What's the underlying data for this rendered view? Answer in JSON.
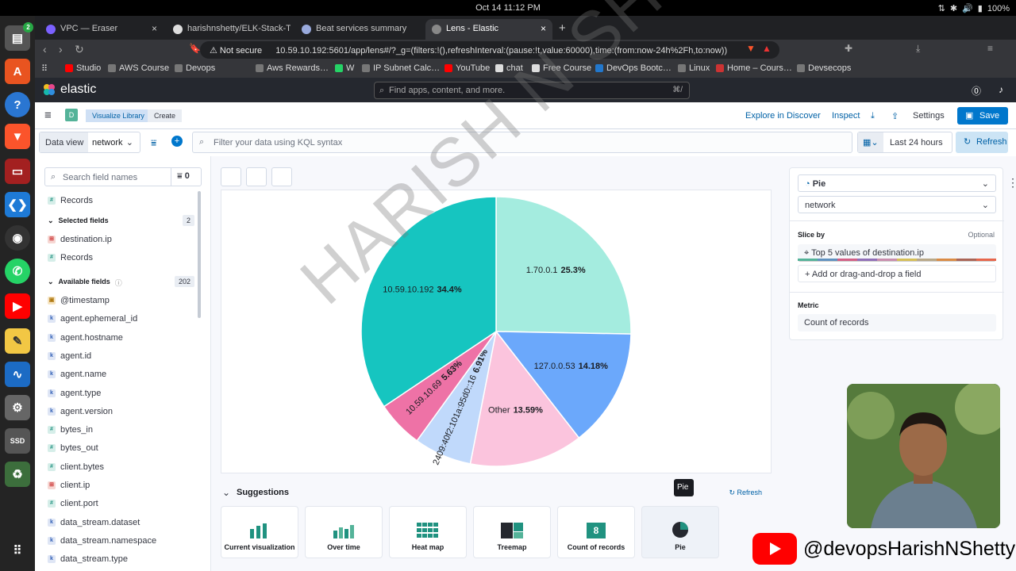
{
  "os": {
    "clock": "Oct 14  11:12 PM",
    "battery": "100%",
    "dock_badge": "2"
  },
  "browser": {
    "tabs": [
      {
        "label": "VPC — Eraser"
      },
      {
        "label": "harishnshetty/ELK-Stack-TLS"
      },
      {
        "label": "Beat services summary"
      },
      {
        "label": "Lens - Elastic",
        "active": true
      }
    ],
    "security": "Not secure",
    "url": "10.59.10.192:5601/app/lens#/?_g=(filters:!(),refreshInterval:(pause:!t,value:60000),time:(from:now-24h%2Fh,to:now))",
    "bookmarks": [
      "Studio",
      "AWS Course",
      "Devops",
      "Aws Rewards…",
      "W",
      "IP Subnet Calc…",
      "YouTube",
      "chat",
      "Free Course",
      "DevOps Bootc…",
      "Linux",
      "Home – Cours…",
      "Devsecops"
    ]
  },
  "kibana": {
    "brand": "elastic",
    "search_placeholder": "Find apps, content, and more.",
    "search_shortcut": "⌘/",
    "space_avatar": "D",
    "breadcrumbs": [
      "Visualize Library",
      "Create"
    ],
    "actions": {
      "explore": "Explore in Discover",
      "inspect": "Inspect",
      "settings": "Settings",
      "save": "Save"
    },
    "query": {
      "data_view_label": "Data view",
      "data_view": "network",
      "kql_placeholder": "Filter your data using KQL syntax",
      "time_range": "Last 24 hours",
      "refresh": "Refresh"
    }
  },
  "sidebar": {
    "search_placeholder": "Search field names",
    "filter_count": "0",
    "top_item": "Records",
    "selected_heading": "Selected fields",
    "selected_count": "2",
    "selected_fields": [
      {
        "name": "destination.ip",
        "type": "ip"
      },
      {
        "name": "Records",
        "type": "num"
      }
    ],
    "available_heading": "Available fields",
    "available_count": "202",
    "available_fields": [
      {
        "name": "@timestamp",
        "type": "date"
      },
      {
        "name": "agent.ephemeral_id",
        "type": "kw"
      },
      {
        "name": "agent.hostname",
        "type": "kw"
      },
      {
        "name": "agent.id",
        "type": "kw"
      },
      {
        "name": "agent.name",
        "type": "kw"
      },
      {
        "name": "agent.type",
        "type": "kw"
      },
      {
        "name": "agent.version",
        "type": "kw"
      },
      {
        "name": "bytes_in",
        "type": "num"
      },
      {
        "name": "bytes_out",
        "type": "num"
      },
      {
        "name": "client.bytes",
        "type": "num"
      },
      {
        "name": "client.ip",
        "type": "ip"
      },
      {
        "name": "client.port",
        "type": "num"
      },
      {
        "name": "data_stream.dataset",
        "type": "kw"
      },
      {
        "name": "data_stream.namespace",
        "type": "kw"
      },
      {
        "name": "data_stream.type",
        "type": "kw"
      }
    ]
  },
  "chart_data": {
    "type": "pie",
    "slices": [
      {
        "label": "1.70.0.1",
        "value": 25.3,
        "pct": "25.3%",
        "color": "#a4ecdf"
      },
      {
        "label": "127.0.0.53",
        "value": 14.18,
        "pct": "14.18%",
        "color": "#6ba8fb"
      },
      {
        "label": "Other",
        "value": 13.59,
        "pct": "13.59%",
        "color": "#fbc4dd"
      },
      {
        "label": "2409:40f2:101a:95d0::16",
        "value": 6.91,
        "pct": "6.91%",
        "color": "#c0d9fb"
      },
      {
        "label": "10.59.10.69",
        "value": 5.63,
        "pct": "5.63%",
        "color": "#ee72a6"
      },
      {
        "label": "10.59.10.192",
        "value": 34.4,
        "pct": "34.4%",
        "color": "#16c5c0"
      }
    ]
  },
  "suggestions": {
    "title": "Suggestions",
    "refresh": "Refresh",
    "items": [
      "Current visualization",
      "Over time",
      "Heat map",
      "Treemap",
      "Count of records",
      "Pie"
    ],
    "count_badge": "8",
    "tooltip": "Pie"
  },
  "config": {
    "chart_type": "Pie",
    "data_view": "network",
    "slice_by_label": "Slice by",
    "optional": "Optional",
    "slice_value": "Top 5 values of destination.ip",
    "add_field": "Add or drag-and-drop a field",
    "metric_label": "Metric",
    "metric_value": "Count of records"
  },
  "overlay": {
    "watermark": "HARISH N SHETTY",
    "channel": "@devopsHarishNShetty"
  }
}
